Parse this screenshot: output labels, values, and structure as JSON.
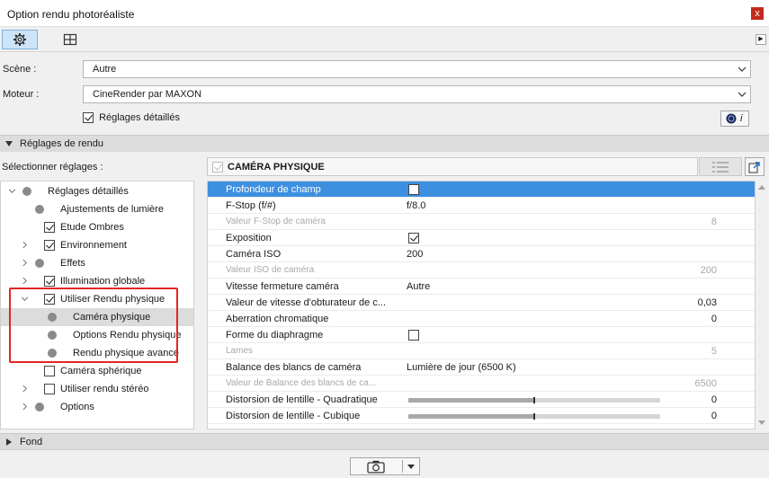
{
  "window": {
    "title": "Option rendu photoréaliste",
    "close_glyph": "x"
  },
  "toolbar": {
    "icons": [
      "gear-icon",
      "layout-panel-icon"
    ],
    "expand_glyph": "▶"
  },
  "scene": {
    "label": "Scène :",
    "value": "Autre"
  },
  "engine": {
    "label": "Moteur :",
    "value": "CineRender par MAXON",
    "detailed_label": "Réglages détaillés",
    "detailed_checked": true,
    "info_glyph": "i"
  },
  "render_section": {
    "label": "Réglages de rendu"
  },
  "select_settings_label": "Sélectionner réglages :",
  "tree": [
    {
      "label": "Réglages détaillés",
      "indent": 0,
      "expander": "open",
      "kind": "dot"
    },
    {
      "label": "Ajustements de lumière",
      "indent": 1,
      "expander": "none",
      "kind": "dot"
    },
    {
      "label": "Etude Ombres",
      "indent": 1,
      "expander": "none",
      "kind": "check",
      "checked": true
    },
    {
      "label": "Environnement",
      "indent": 1,
      "expander": "closed",
      "kind": "check",
      "checked": true
    },
    {
      "label": "Effets",
      "indent": 1,
      "expander": "closed",
      "kind": "dot"
    },
    {
      "label": "Illumination globale",
      "indent": 1,
      "expander": "closed",
      "kind": "check",
      "checked": true
    },
    {
      "label": "Utiliser Rendu physique",
      "indent": 1,
      "expander": "open",
      "kind": "check",
      "checked": true
    },
    {
      "label": "Caméra physique",
      "indent": 2,
      "expander": "none",
      "kind": "dot",
      "selected": true
    },
    {
      "label": "Options Rendu physique",
      "indent": 2,
      "expander": "none",
      "kind": "dot"
    },
    {
      "label": "Rendu physique avancé",
      "indent": 2,
      "expander": "none",
      "kind": "dot"
    },
    {
      "label": "Caméra sphérique",
      "indent": 1,
      "expander": "none",
      "kind": "check",
      "checked": false
    },
    {
      "label": "Utiliser rendu stéréo",
      "indent": 1,
      "expander": "closed",
      "kind": "check",
      "checked": false
    },
    {
      "label": "Options",
      "indent": 1,
      "expander": "closed",
      "kind": "dot"
    }
  ],
  "panel": {
    "title": "CAMÉRA PHYSIQUE",
    "title_checked": true
  },
  "params": [
    {
      "name": "Profondeur de champ",
      "type": "check",
      "checked": false,
      "selected": true
    },
    {
      "name": "F-Stop (f/#)",
      "type": "text",
      "value": "f/8.0"
    },
    {
      "name": "Valeur F-Stop de caméra",
      "type": "num",
      "value": "8",
      "dim": true
    },
    {
      "name": "Exposition",
      "type": "check",
      "checked": true
    },
    {
      "name": "Caméra ISO",
      "type": "text",
      "value": "200"
    },
    {
      "name": "Valeur ISO de caméra",
      "type": "num",
      "value": "200",
      "dim": true
    },
    {
      "name": "Vitesse fermeture caméra",
      "type": "text",
      "value": "Autre"
    },
    {
      "name": "Valeur de vitesse d'obturateur de c...",
      "type": "num",
      "value": "0,03"
    },
    {
      "name": "Aberration chromatique",
      "type": "num",
      "value": "0"
    },
    {
      "name": "Forme du diaphragme",
      "type": "check",
      "checked": false
    },
    {
      "name": "Lames",
      "type": "num",
      "value": "5",
      "dim": true
    },
    {
      "name": "Balance des blancs de caméra",
      "type": "text",
      "value": "Lumière de jour (6500 K)"
    },
    {
      "name": "Valeur de Balance des blancs de ca...",
      "type": "num",
      "value": "6500",
      "dim": true
    },
    {
      "name": "Distorsion de lentille - Quadratique",
      "type": "slider",
      "value": "0",
      "level": 0.5
    },
    {
      "name": "Distorsion de lentille - Cubique",
      "type": "slider",
      "value": "0",
      "level": 0.5
    }
  ],
  "background_section": {
    "label": "Fond"
  },
  "colors": {
    "selection": "#3d8fe0",
    "highlight_box": "#e52525",
    "active_tab": "#cde3f7"
  }
}
